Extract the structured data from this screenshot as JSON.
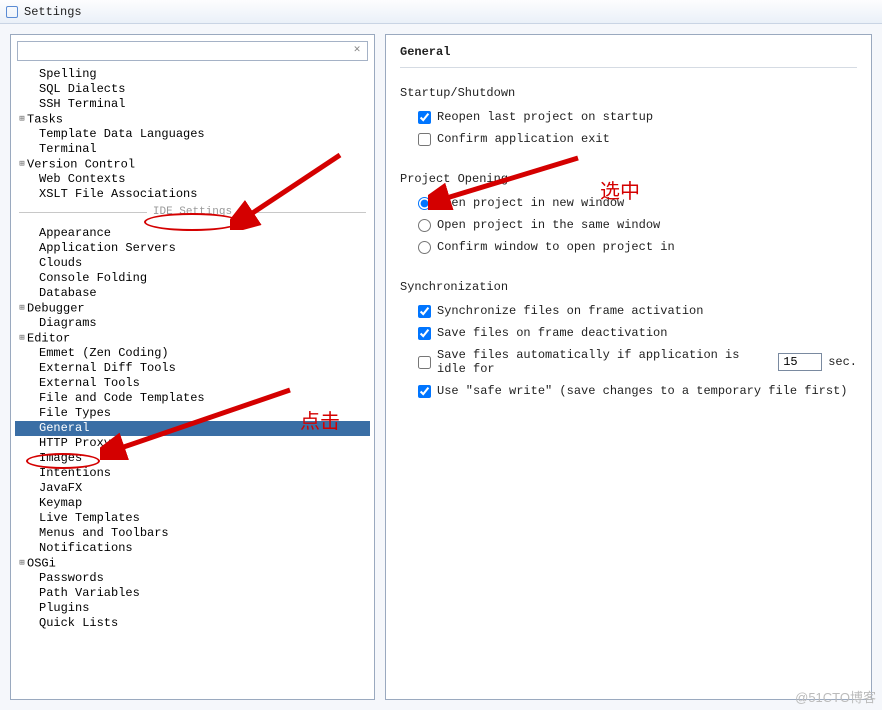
{
  "window": {
    "title": "Settings"
  },
  "search": {
    "placeholder": ""
  },
  "tree": {
    "section1": [
      {
        "label": "Spelling",
        "indent": 1,
        "exp": false
      },
      {
        "label": "SQL Dialects",
        "indent": 1,
        "exp": false
      },
      {
        "label": "SSH Terminal",
        "indent": 1,
        "exp": false
      },
      {
        "label": "Tasks",
        "indent": 0,
        "exp": true
      },
      {
        "label": "Template Data Languages",
        "indent": 1,
        "exp": false
      },
      {
        "label": "Terminal",
        "indent": 1,
        "exp": false
      },
      {
        "label": "Version Control",
        "indent": 0,
        "exp": true
      },
      {
        "label": "Web Contexts",
        "indent": 1,
        "exp": false
      },
      {
        "label": "XSLT File Associations",
        "indent": 1,
        "exp": false
      }
    ],
    "separator": "IDE Settings",
    "section2": [
      {
        "label": "Appearance",
        "indent": 1,
        "exp": false
      },
      {
        "label": "Application Servers",
        "indent": 1,
        "exp": false
      },
      {
        "label": "Clouds",
        "indent": 1,
        "exp": false
      },
      {
        "label": "Console Folding",
        "indent": 1,
        "exp": false
      },
      {
        "label": "Database",
        "indent": 1,
        "exp": false
      },
      {
        "label": "Debugger",
        "indent": 0,
        "exp": true
      },
      {
        "label": "Diagrams",
        "indent": 1,
        "exp": false
      },
      {
        "label": "Editor",
        "indent": 0,
        "exp": true
      },
      {
        "label": "Emmet (Zen Coding)",
        "indent": 1,
        "exp": false
      },
      {
        "label": "External Diff Tools",
        "indent": 1,
        "exp": false
      },
      {
        "label": "External Tools",
        "indent": 1,
        "exp": false
      },
      {
        "label": "File and Code Templates",
        "indent": 1,
        "exp": false
      },
      {
        "label": "File Types",
        "indent": 1,
        "exp": false
      },
      {
        "label": "General",
        "indent": 1,
        "exp": false,
        "selected": true
      },
      {
        "label": "HTTP Proxy",
        "indent": 1,
        "exp": false
      },
      {
        "label": "Images",
        "indent": 1,
        "exp": false
      },
      {
        "label": "Intentions",
        "indent": 1,
        "exp": false
      },
      {
        "label": "JavaFX",
        "indent": 1,
        "exp": false
      },
      {
        "label": "Keymap",
        "indent": 1,
        "exp": false
      },
      {
        "label": "Live Templates",
        "indent": 1,
        "exp": false
      },
      {
        "label": "Menus and Toolbars",
        "indent": 1,
        "exp": false
      },
      {
        "label": "Notifications",
        "indent": 1,
        "exp": false
      },
      {
        "label": "OSGi",
        "indent": 0,
        "exp": true
      },
      {
        "label": "Passwords",
        "indent": 1,
        "exp": false
      },
      {
        "label": "Path Variables",
        "indent": 1,
        "exp": false
      },
      {
        "label": "Plugins",
        "indent": 1,
        "exp": false
      },
      {
        "label": "Quick Lists",
        "indent": 1,
        "exp": false
      }
    ]
  },
  "panel": {
    "title": "General",
    "startup": {
      "title": "Startup/Shutdown",
      "reopen": "Reopen last project on startup",
      "confirmExit": "Confirm application exit"
    },
    "opening": {
      "title": "Project Opening",
      "newWin": "Open project in new window",
      "sameWin": "Open project in the same window",
      "confirm": "Confirm window to open project in"
    },
    "sync": {
      "title": "Synchronization",
      "onAct": "Synchronize files on frame activation",
      "onDeact": "Save files on frame deactivation",
      "autoPre": "Save files automatically if application is idle for",
      "autoVal": "15",
      "autoPost": "sec.",
      "safeWrite": "Use \"safe write\" (save changes to a temporary file first)"
    }
  },
  "annotations": {
    "label1": "选中",
    "label2": "点击"
  },
  "watermark": "@51CTO博客"
}
